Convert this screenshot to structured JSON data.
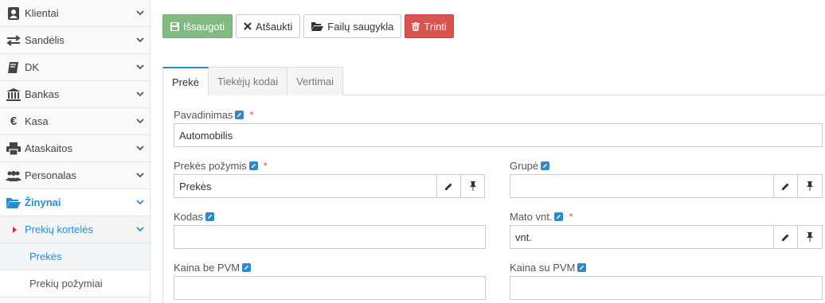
{
  "sidebar": {
    "items": [
      {
        "label": "Klientai",
        "icon": "user-card-icon"
      },
      {
        "label": "Sandėlis",
        "icon": "exchange-icon"
      },
      {
        "label": "DK",
        "icon": "book-icon"
      },
      {
        "label": "Bankas",
        "icon": "bank-icon"
      },
      {
        "label": "Kasa",
        "icon": "euro-icon"
      },
      {
        "label": "Ataskaitos",
        "icon": "print-icon"
      },
      {
        "label": "Personalas",
        "icon": "users-icon"
      },
      {
        "label": "Žinynai",
        "icon": "folder-open-icon"
      }
    ],
    "subgroup": {
      "label": "Prekių kortelės"
    },
    "leaves": [
      {
        "label": "Prekės"
      },
      {
        "label": "Prekių požymiai"
      }
    ]
  },
  "toolbar": {
    "save_label": "Išsaugoti",
    "cancel_label": "Atšaukti",
    "files_label": "Failų saugykla",
    "delete_label": "Trinti"
  },
  "tabs": [
    {
      "label": "Prekė"
    },
    {
      "label": "Tiekėjų kodai"
    },
    {
      "label": "Vertimai"
    }
  ],
  "form": {
    "name_label": "Pavadinimas",
    "name_value": "Automobilis",
    "feature_label": "Prekės požymis",
    "feature_value": "Prekės",
    "group_label": "Grupė",
    "group_value": "",
    "code_label": "Kodas",
    "code_value": "",
    "unit_label": "Mato vnt.",
    "unit_value": "vnt.",
    "price_ex_label": "Kaina be PVM",
    "price_ex_value": "",
    "price_inc_label": "Kaina su PVM",
    "price_inc_value": "",
    "required_mark": "*"
  },
  "colors": {
    "accent": "#2a8bd0",
    "save": "#82bb82",
    "delete": "#d9534f"
  }
}
